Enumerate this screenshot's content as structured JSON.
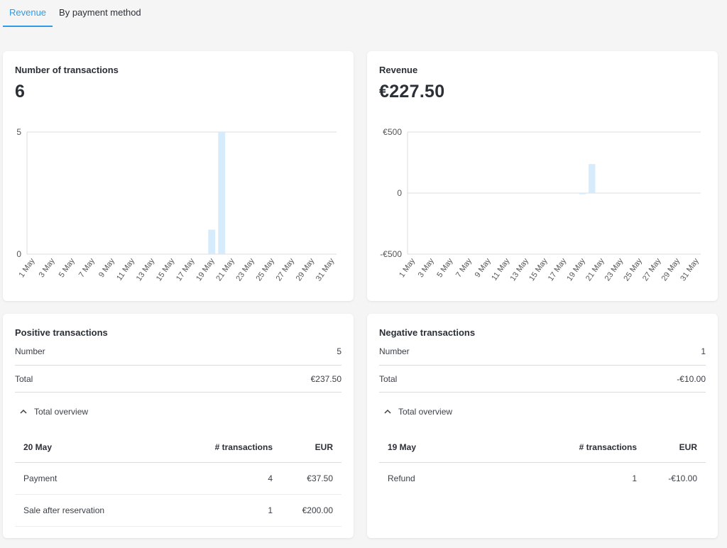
{
  "tabs": [
    {
      "label": "Revenue",
      "active": true
    },
    {
      "label": "By payment method",
      "active": false
    }
  ],
  "transactions_card": {
    "title": "Number of transactions",
    "value": "6"
  },
  "revenue_card": {
    "title": "Revenue",
    "value": "€227.50"
  },
  "positive": {
    "title": "Positive transactions",
    "number_label": "Number",
    "number_value": "5",
    "total_label": "Total",
    "total_value": "€237.50",
    "overview_label": "Total overview",
    "table": {
      "date": "20 May",
      "col_transactions": "# transactions",
      "col_currency": "EUR",
      "rows": [
        {
          "label": "Payment",
          "count": "4",
          "amount": "€37.50"
        },
        {
          "label": "Sale after reservation",
          "count": "1",
          "amount": "€200.00"
        }
      ]
    }
  },
  "negative": {
    "title": "Negative transactions",
    "number_label": "Number",
    "number_value": "1",
    "total_label": "Total",
    "total_value": "-€10.00",
    "overview_label": "Total overview",
    "table": {
      "date": "19 May",
      "col_transactions": "# transactions",
      "col_currency": "EUR",
      "rows": [
        {
          "label": "Refund",
          "count": "1",
          "amount": "-€10.00"
        }
      ]
    }
  },
  "colors": {
    "accent": "#2e9be6",
    "bar": "#d6ecfc",
    "grid": "#dcdcdc"
  },
  "chart_data": [
    {
      "type": "bar",
      "title": "Number of transactions",
      "x_tick_labels": [
        "1 May",
        "3 May",
        "5 May",
        "7 May",
        "9 May",
        "11 May",
        "13 May",
        "15 May",
        "17 May",
        "19 May",
        "21 May",
        "23 May",
        "25 May",
        "27 May",
        "29 May",
        "31 May"
      ],
      "y_tick_labels": [
        "5",
        "0"
      ],
      "ylim": [
        0,
        5
      ],
      "x_days": [
        1,
        2,
        3,
        4,
        5,
        6,
        7,
        8,
        9,
        10,
        11,
        12,
        13,
        14,
        15,
        16,
        17,
        18,
        19,
        20,
        21,
        22,
        23,
        24,
        25,
        26,
        27,
        28,
        29,
        30,
        31
      ],
      "values": [
        0,
        0,
        0,
        0,
        0,
        0,
        0,
        0,
        0,
        0,
        0,
        0,
        0,
        0,
        0,
        0,
        0,
        0,
        1,
        5,
        0,
        0,
        0,
        0,
        0,
        0,
        0,
        0,
        0,
        0,
        0
      ],
      "grid": true
    },
    {
      "type": "bar",
      "title": "Revenue",
      "x_tick_labels": [
        "1 May",
        "3 May",
        "5 May",
        "7 May",
        "9 May",
        "11 May",
        "13 May",
        "15 May",
        "17 May",
        "19 May",
        "21 May",
        "23 May",
        "25 May",
        "27 May",
        "29 May",
        "31 May"
      ],
      "y_tick_labels": [
        "€500",
        "0",
        "-€500"
      ],
      "ylim": [
        -500,
        500
      ],
      "x_days": [
        1,
        2,
        3,
        4,
        5,
        6,
        7,
        8,
        9,
        10,
        11,
        12,
        13,
        14,
        15,
        16,
        17,
        18,
        19,
        20,
        21,
        22,
        23,
        24,
        25,
        26,
        27,
        28,
        29,
        30,
        31
      ],
      "values": [
        0,
        0,
        0,
        0,
        0,
        0,
        0,
        0,
        0,
        0,
        0,
        0,
        0,
        0,
        0,
        0,
        0,
        0,
        -10,
        237.5,
        0,
        0,
        0,
        0,
        0,
        0,
        0,
        0,
        0,
        0,
        0
      ],
      "grid": true
    }
  ]
}
